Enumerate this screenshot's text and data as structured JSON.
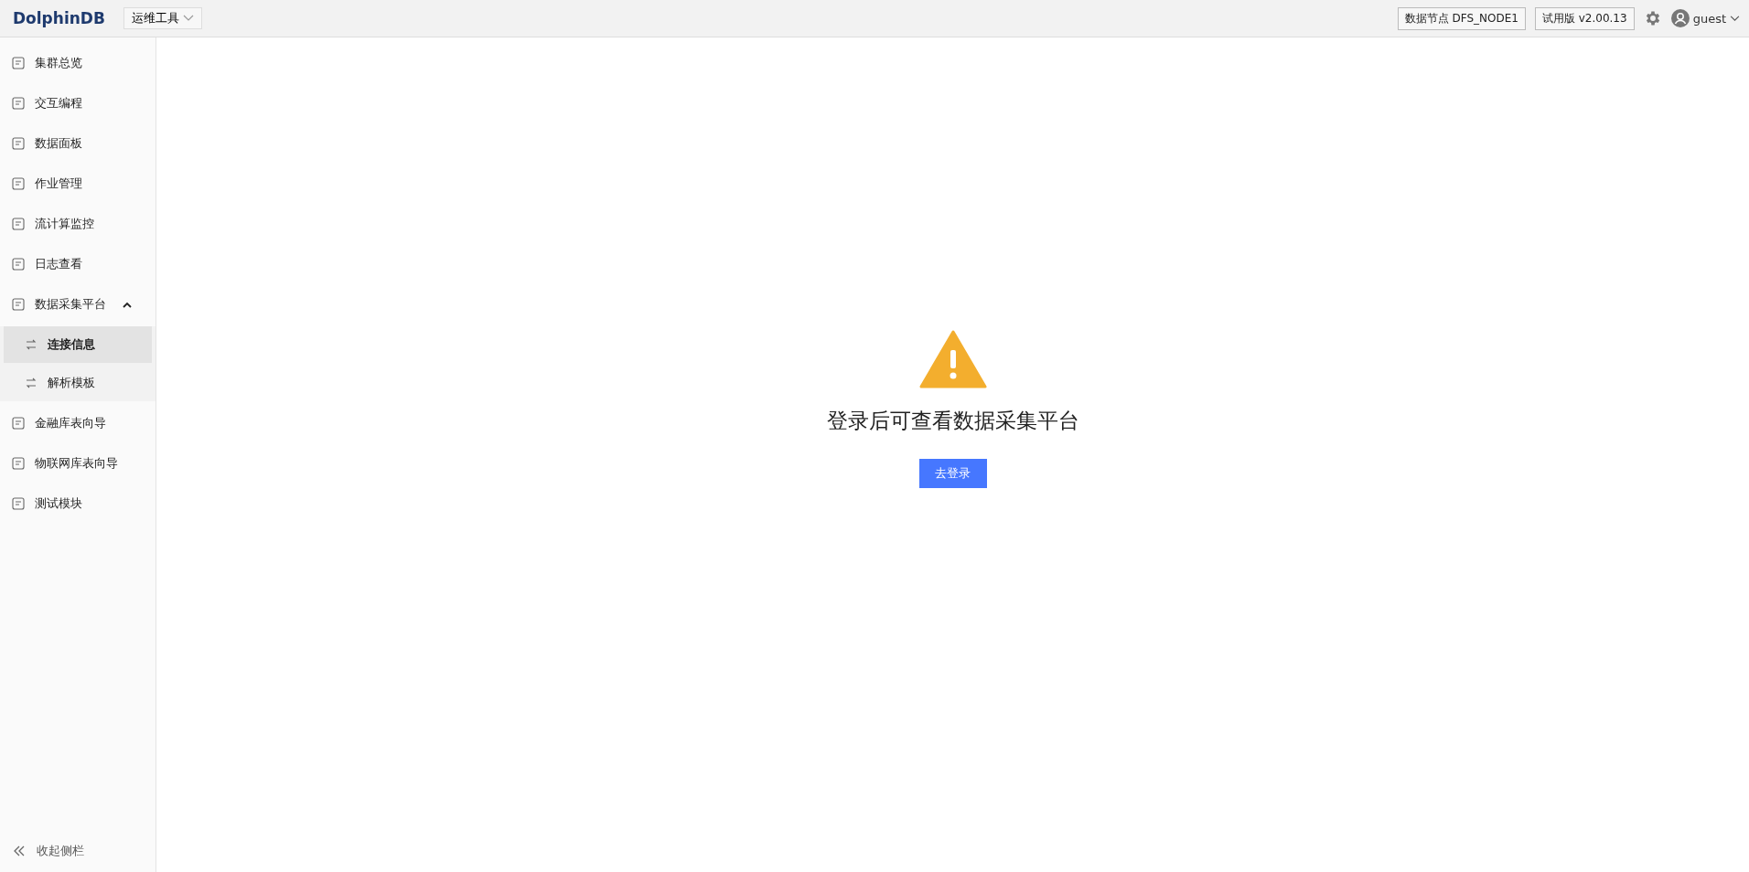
{
  "header": {
    "logo": "DolphinDB",
    "tool_menu": "运维工具",
    "node_badge": "数据节点 DFS_NODE1",
    "version_badge": "试用版 v2.00.13",
    "user": "guest"
  },
  "sidebar": {
    "items": [
      {
        "label": "集群总览",
        "selected": false
      },
      {
        "label": "交互编程",
        "selected": false
      },
      {
        "label": "数据面板",
        "selected": false
      },
      {
        "label": "作业管理",
        "selected": false
      },
      {
        "label": "流计算监控",
        "selected": false
      },
      {
        "label": "日志查看",
        "selected": false
      },
      {
        "label": "数据采集平台",
        "selected": false,
        "expanded": true,
        "children": [
          {
            "label": "连接信息",
            "selected": true
          },
          {
            "label": "解析模板",
            "selected": false
          }
        ]
      },
      {
        "label": "金融库表向导",
        "selected": false
      },
      {
        "label": "物联网库表向导",
        "selected": false
      },
      {
        "label": "测试模块",
        "selected": false
      }
    ],
    "collapse": "收起侧栏"
  },
  "main": {
    "message": "登录后可查看数据采集平台",
    "button": "去登录"
  }
}
